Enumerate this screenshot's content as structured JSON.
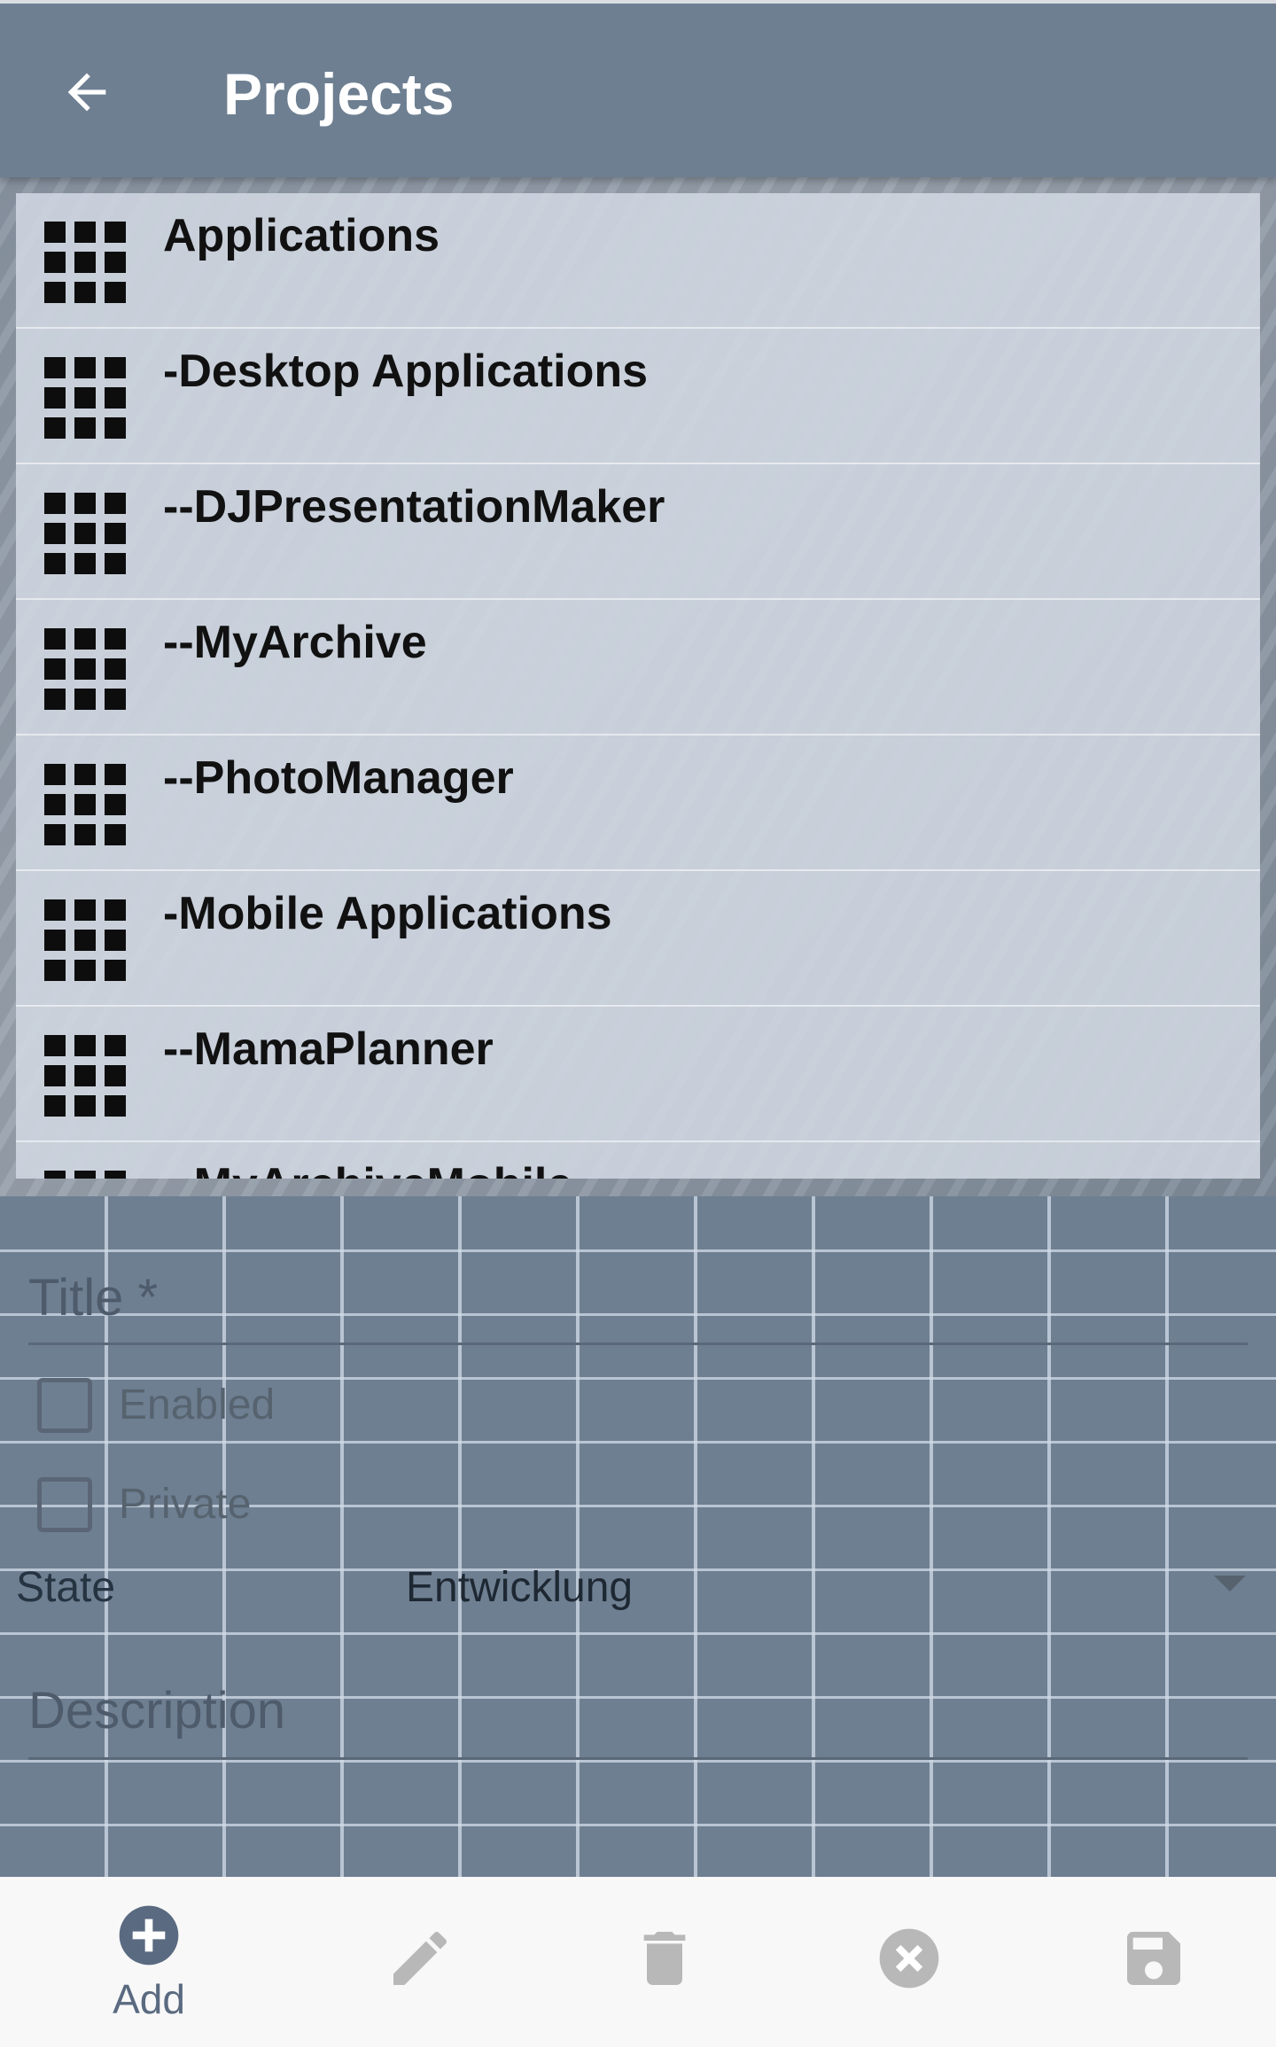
{
  "appbar": {
    "back_icon": "arrow-left-icon",
    "title": "Projects"
  },
  "projects": [
    {
      "label": "Applications",
      "icon": "apps-grid-icon"
    },
    {
      "label": "-Desktop Applications",
      "icon": "apps-grid-icon"
    },
    {
      "label": "--DJPresentationMaker",
      "icon": "apps-grid-icon"
    },
    {
      "label": "--MyArchive",
      "icon": "apps-grid-icon"
    },
    {
      "label": "--PhotoManager",
      "icon": "apps-grid-icon"
    },
    {
      "label": "-Mobile Applications",
      "icon": "apps-grid-icon"
    },
    {
      "label": "--MamaPlanner",
      "icon": "apps-grid-icon"
    },
    {
      "label": "--MyArchiveMobile",
      "icon": "apps-grid-icon"
    }
  ],
  "form": {
    "title_label": "Title *",
    "enabled_label": "Enabled",
    "private_label": "Private",
    "state_label": "State",
    "state_value": "Entwicklung",
    "description_label": "Description"
  },
  "bottom_bar": {
    "add_label": "Add",
    "add_icon": "add-circle-icon",
    "edit_icon": "pencil-icon",
    "delete_icon": "trash-icon",
    "cancel_icon": "cancel-circle-icon",
    "save_icon": "save-icon"
  },
  "colors": {
    "appbar": "#6e7f92",
    "list_background": "#d0d7e1",
    "bottom_icon_active": "#5a6a80",
    "bottom_icon_disabled": "#b8b8b8"
  }
}
